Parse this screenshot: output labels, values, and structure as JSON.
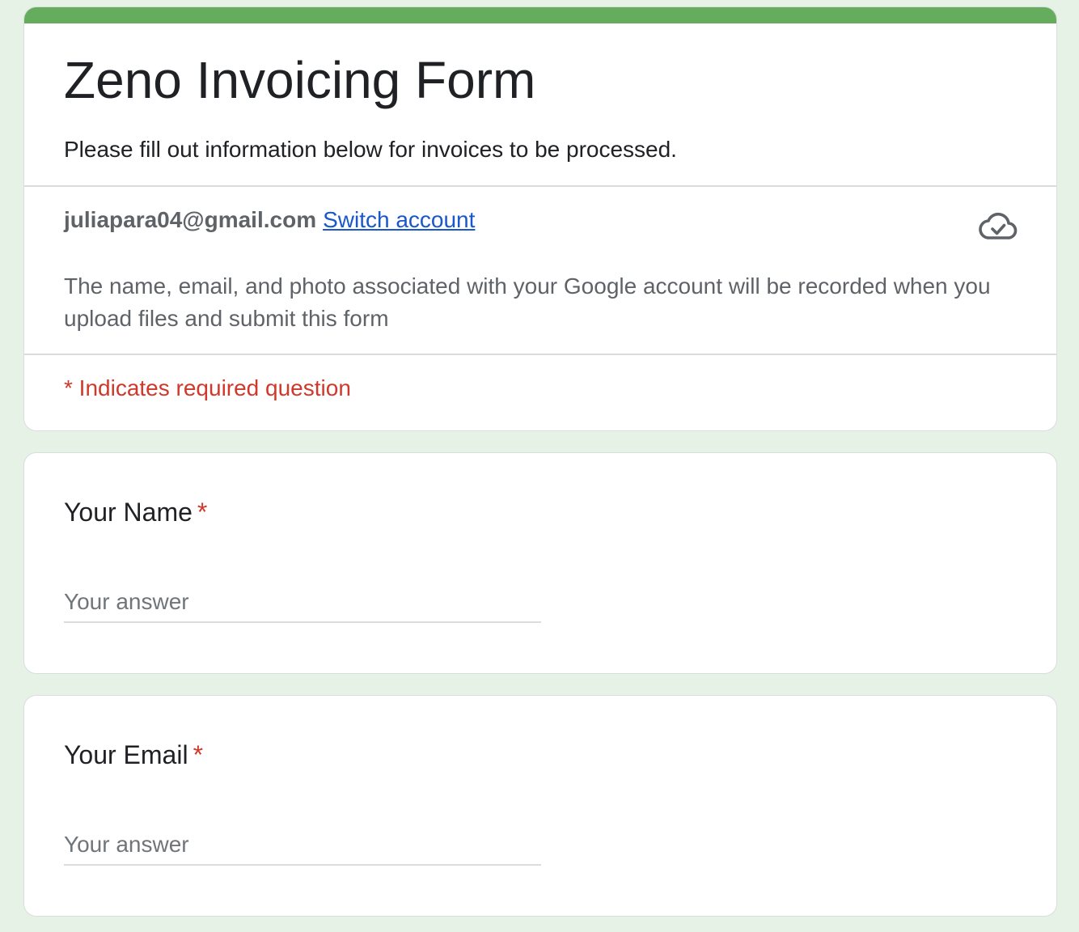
{
  "form": {
    "title": "Zeno Invoicing Form",
    "description": "Please fill out information below for invoices to be processed.",
    "account_email": "juliapara04@gmail.com",
    "switch_account_label": "Switch account",
    "save_status_icon": "cloud-check-icon",
    "notice": "The name, email, and photo associated with your Google account will be recorded when you upload files and submit this form",
    "required_note": "* Indicates required question"
  },
  "questions": [
    {
      "label": "Your Name",
      "required_marker": "*",
      "value": "",
      "placeholder": "Your answer"
    },
    {
      "label": "Your Email",
      "required_marker": "*",
      "value": "",
      "placeholder": "Your answer"
    }
  ],
  "colors": {
    "theme_accent": "#65ad5d",
    "page_background": "#e6f2e5",
    "required_red": "#d0382b",
    "link_blue": "#1a57c9"
  }
}
